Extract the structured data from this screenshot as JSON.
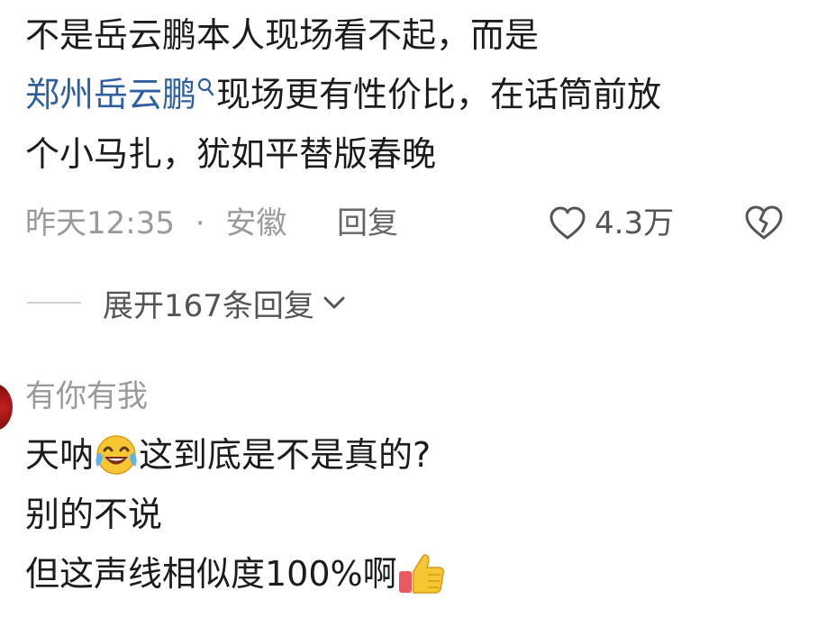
{
  "comment": {
    "line1": "不是岳云鹏本人现场看不起，而是",
    "link_text": "郑州岳云鹏",
    "line2_rest": "现场更有性价比，在话筒前放",
    "line3": "个小马扎，犹如平替版春晚"
  },
  "meta": {
    "time": "昨天12:35",
    "separator": "·",
    "location": "安徽",
    "reply_label": "回复",
    "like_count": "4.3万"
  },
  "expand": {
    "label": "展开167条回复"
  },
  "reply": {
    "username": "有你有我",
    "line1_a": "天呐",
    "line1_b": "这到底是不是真的?",
    "line2": "别的不说",
    "line3": "但这声线相似度100%啊"
  },
  "colors": {
    "link": "#2f5f9e",
    "meta": "#9a9a9a",
    "text": "#1c1c1c"
  },
  "icons": [
    "search-mini-icon",
    "heart-outline-icon",
    "broken-heart-icon",
    "chevron-down-icon",
    "laughing-tears-emoji",
    "thumbs-up-emoji"
  ]
}
